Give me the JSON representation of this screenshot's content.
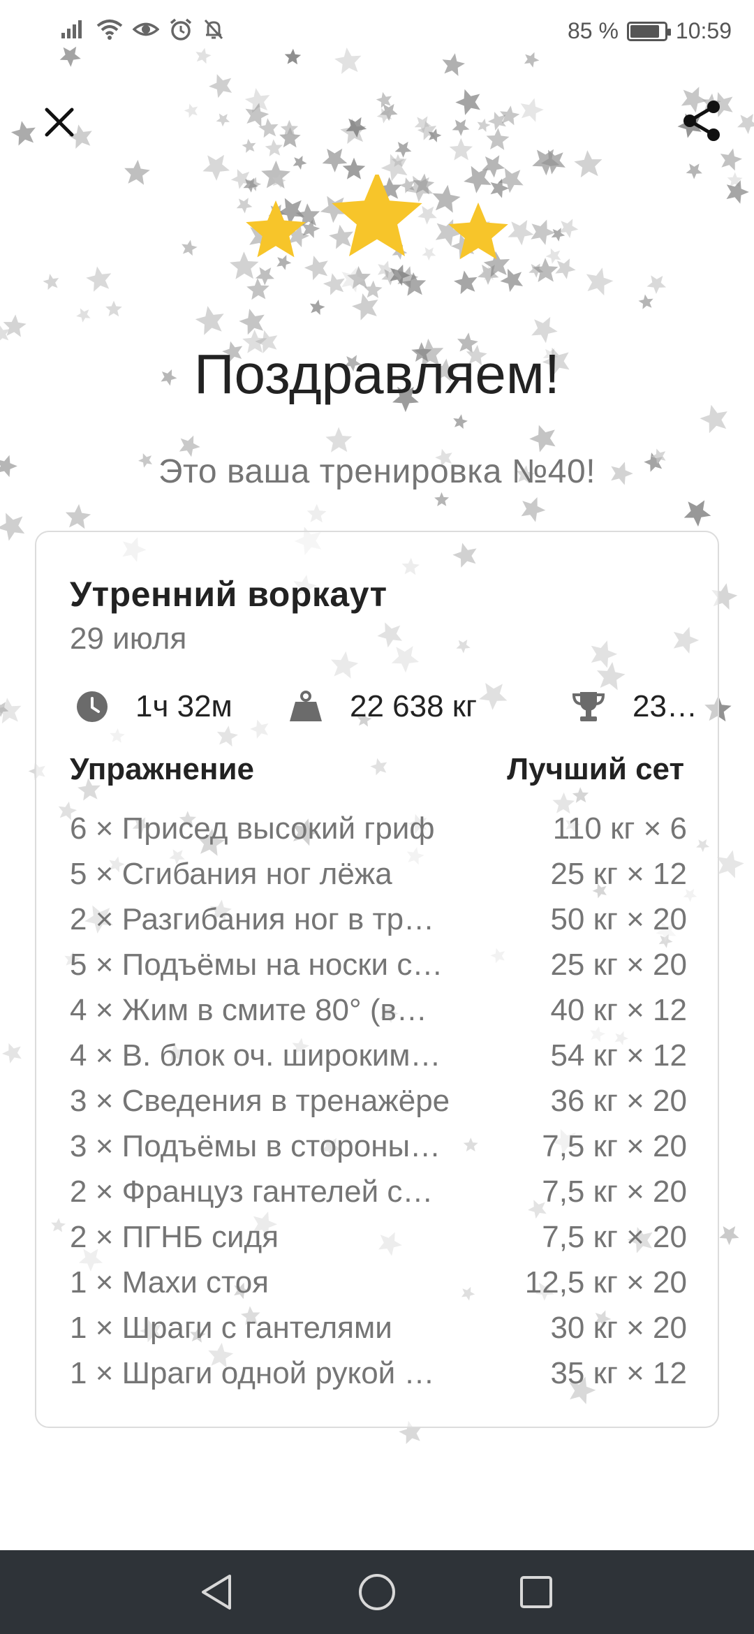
{
  "status_bar": {
    "battery_percent_text": "85 %",
    "battery_level": 0.85,
    "time": "10:59",
    "icons": [
      "signal-icon",
      "wifi-icon",
      "eye-icon",
      "alarm-icon",
      "notifications-off-icon"
    ]
  },
  "header": {
    "close_icon": "close-icon",
    "share_icon": "share-icon"
  },
  "rating": {
    "stars_filled": 3,
    "stars_total": 3,
    "color": "#F7C52A"
  },
  "headline": "Поздравляем!",
  "subline": "Это ваша тренировка №40!",
  "workout": {
    "title": "Утренний воркаут",
    "date": "29 июля",
    "stats": {
      "duration": "1ч 32м",
      "volume": "22 638 кг",
      "records": "23…"
    },
    "columns": {
      "exercise": "Упражнение",
      "best_set": "Лучший сет"
    },
    "exercises": [
      {
        "name": "6 × Присед высокий гриф",
        "best": "110 кг × 6"
      },
      {
        "name": "5 × Сгибания ног лёжа",
        "best": "25 кг × 12"
      },
      {
        "name": "2 × Разгибания ног в тр…",
        "best": "50 кг × 20"
      },
      {
        "name": "5 × Подъёмы на носки с…",
        "best": "25 кг × 20"
      },
      {
        "name": "4 × Жим в смите 80° (в…",
        "best": "40 кг × 12"
      },
      {
        "name": "4 × В. блок оч. широким…",
        "best": "54 кг × 12"
      },
      {
        "name": "3 × Сведения в тренажёре",
        "best": "36 кг × 20"
      },
      {
        "name": "3 × Подъёмы в стороны…",
        "best": "7,5 кг × 20"
      },
      {
        "name": "2 × Француз гантелей с…",
        "best": "7,5 кг × 20"
      },
      {
        "name": "2 × ПГНБ сидя",
        "best": "7,5 кг × 20"
      },
      {
        "name": "1 × Махи стоя",
        "best": "12,5 кг × 20"
      },
      {
        "name": "1 × Шраги с гантелями",
        "best": "30 кг × 20"
      },
      {
        "name": "1 × Шраги одной рукой …",
        "best": "35 кг × 12"
      }
    ]
  },
  "nav_bar": {
    "icons": [
      "back-icon",
      "home-icon",
      "recents-icon"
    ],
    "background": "#2E3338"
  }
}
